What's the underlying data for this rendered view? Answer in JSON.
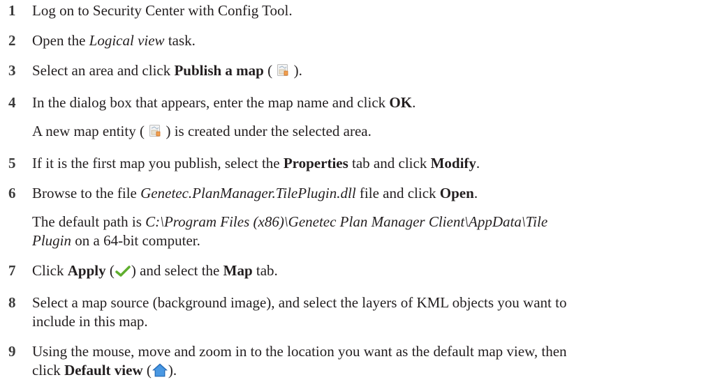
{
  "steps": [
    {
      "num": "1",
      "pre": "Log on to Security Center with Config Tool."
    },
    {
      "num": "2",
      "pre": "Open the ",
      "ital": "Logical view",
      "post": " task."
    },
    {
      "num": "3",
      "pre": "Select an area and click ",
      "bold": "Publish a map",
      "mid": " ( ",
      "end": " )."
    },
    {
      "num": "4",
      "pre": "In the dialog box that appears, enter the map name and click ",
      "bold": "OK",
      "post": ".",
      "note_pre": "A new map entity ( ",
      "note_post": " ) is created under the selected area."
    },
    {
      "num": "5",
      "pre": "If it is the first map you publish, select the ",
      "bold": "Properties",
      "mid": " tab and click ",
      "bold2": "Modify",
      "post": "."
    },
    {
      "num": "6",
      "pre": "Browse to the file ",
      "ital": "Genetec.PlanManager.TilePlugin.dll",
      "mid": " file and click ",
      "bold": "Open",
      "post": ".",
      "note_pre": "The default path is ",
      "note_ital": "C:\\Program Files (x86)\\Genetec Plan Manager Client\\AppData\\Tile",
      "note_ital2": "Plugin",
      "note_post": " on a 64-bit computer."
    },
    {
      "num": "7",
      "pre": "Click ",
      "bold": "Apply",
      "mid": " (",
      "mid2": ") and select the ",
      "bold2": "Map",
      "post": " tab."
    },
    {
      "num": "8",
      "pre": "Select a map source (background image), and select the layers of KML objects you want to",
      "line2": "include in this map."
    },
    {
      "num": "9",
      "pre": "Using the mouse, move and zoom in to the location you want as the default map view, then",
      "line2_pre": "click ",
      "bold": "Default view",
      "mid": " (",
      "post": ")."
    }
  ],
  "colors": {
    "text": "#231f20",
    "check": "#5fae2e",
    "home": "#2f7fd0"
  },
  "icons": [
    "publish-map-icon",
    "map-entity-icon",
    "apply-check-icon",
    "default-view-home-icon"
  ]
}
